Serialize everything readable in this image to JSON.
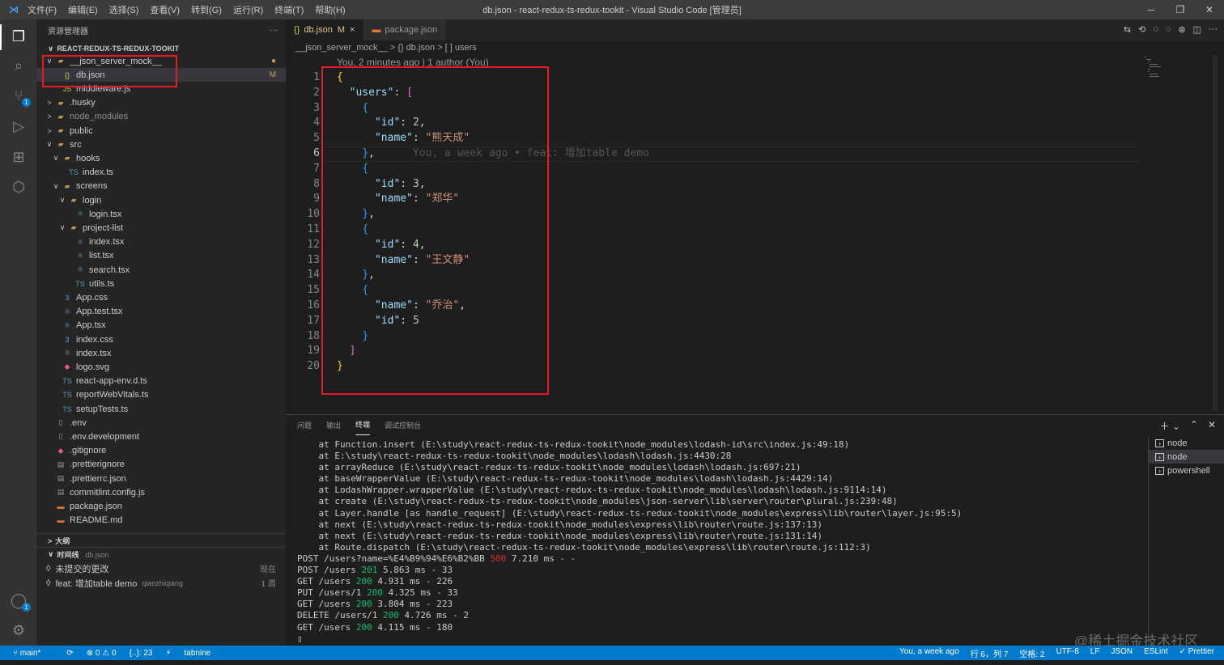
{
  "window": {
    "title": "db.json - react-redux-ts-redux-tookit - Visual Studio Code [管理员]",
    "menu": [
      "文件(F)",
      "编辑(E)",
      "选择(S)",
      "查看(V)",
      "转到(G)",
      "运行(R)",
      "终端(T)",
      "帮助(H)"
    ]
  },
  "activity": {
    "scm_badge": "1",
    "account_badge": "1"
  },
  "sidebar": {
    "header": "资源管理器",
    "more": "···",
    "project": "REACT-REDUX-TS-REDUX-TOOKIT",
    "tree": [
      {
        "label": "__json_server_mock__",
        "chev": "∨",
        "icon": "folder",
        "indent": 0,
        "status": "●"
      },
      {
        "label": "db.json",
        "chev": "",
        "icon": "{}",
        "indent": 1,
        "status": "M",
        "selected": true
      },
      {
        "label": "middleware.js",
        "chev": "",
        "icon": "JS",
        "indent": 1
      },
      {
        "label": ".husky",
        "chev": ">",
        "icon": "folder",
        "indent": 0
      },
      {
        "label": "node_modules",
        "chev": ">",
        "icon": "folder",
        "indent": 0,
        "dim": true
      },
      {
        "label": "public",
        "chev": ">",
        "icon": "folder",
        "indent": 0
      },
      {
        "label": "src",
        "chev": "∨",
        "icon": "folder",
        "indent": 0
      },
      {
        "label": "hooks",
        "chev": "∨",
        "icon": "folder",
        "indent": 1
      },
      {
        "label": "index.ts",
        "chev": "",
        "icon": "TS",
        "indent": 2
      },
      {
        "label": "screens",
        "chev": "∨",
        "icon": "folder",
        "indent": 1
      },
      {
        "label": "login",
        "chev": "∨",
        "icon": "folder",
        "indent": 2
      },
      {
        "label": "login.tsx",
        "chev": "",
        "icon": "⚛",
        "indent": 3
      },
      {
        "label": "project-list",
        "chev": "∨",
        "icon": "folder",
        "indent": 2
      },
      {
        "label": "index.tsx",
        "chev": "",
        "icon": "⚛",
        "indent": 3
      },
      {
        "label": "list.tsx",
        "chev": "",
        "icon": "⚛",
        "indent": 3
      },
      {
        "label": "search.tsx",
        "chev": "",
        "icon": "⚛",
        "indent": 3
      },
      {
        "label": "utils.ts",
        "chev": "",
        "icon": "TS",
        "indent": 3
      },
      {
        "label": "App.css",
        "chev": "",
        "icon": "3",
        "indent": 1
      },
      {
        "label": "App.test.tsx",
        "chev": "",
        "icon": "⚛",
        "indent": 1
      },
      {
        "label": "App.tsx",
        "chev": "",
        "icon": "⚛",
        "indent": 1
      },
      {
        "label": "index.css",
        "chev": "",
        "icon": "3",
        "indent": 1
      },
      {
        "label": "index.tsx",
        "chev": "",
        "icon": "⚛",
        "indent": 1
      },
      {
        "label": "logo.svg",
        "chev": "",
        "icon": "◆",
        "indent": 1
      },
      {
        "label": "react-app-env.d.ts",
        "chev": "",
        "icon": "TS",
        "indent": 1
      },
      {
        "label": "reportWebVitals.ts",
        "chev": "",
        "icon": "TS",
        "indent": 1
      },
      {
        "label": "setupTests.ts",
        "chev": "",
        "icon": "TS",
        "indent": 1
      },
      {
        "label": ".env",
        "chev": "",
        "icon": "▯",
        "indent": 0
      },
      {
        "label": ".env.development",
        "chev": "",
        "icon": "▯",
        "indent": 0
      },
      {
        "label": ".gitignore",
        "chev": "",
        "icon": "◆",
        "indent": 0
      },
      {
        "label": ".prettierignore",
        "chev": "",
        "icon": "▤",
        "indent": 0
      },
      {
        "label": ".prettierrc.json",
        "chev": "",
        "icon": "▤",
        "indent": 0
      },
      {
        "label": "commitlint.config.js",
        "chev": "",
        "icon": "▤",
        "indent": 0
      },
      {
        "label": "package.json",
        "chev": "",
        "icon": "▬",
        "indent": 0
      },
      {
        "label": "README.md",
        "chev": "",
        "icon": "▬",
        "indent": 0
      }
    ],
    "outline": "大纲",
    "timeline": {
      "title": "时间线",
      "file": "db.json",
      "items": [
        {
          "label": "未提交的更改",
          "author": "",
          "when": "现在"
        },
        {
          "label": "feat: 增加table demo",
          "author": "qiaozhiqiang",
          "when": "1 周"
        }
      ]
    }
  },
  "editor": {
    "tabs": [
      {
        "label": "db.json",
        "icon": "{}",
        "status": "M",
        "close": "×",
        "active": true
      },
      {
        "label": "package.json",
        "icon": "▬",
        "active": false
      }
    ],
    "breadcrumbs": "__json_server_mock__ > {} db.json > [ ] users",
    "codelens": "You, 2 minutes ago | 1 author (You)",
    "blame": "You, a week ago • feat: 增加table demo",
    "current_line": 6
  },
  "code_lines": [
    [
      [
        "b1",
        "{"
      ]
    ],
    [
      [
        "p",
        "  "
      ],
      [
        "k",
        "\"users\""
      ],
      [
        "p",
        ": "
      ],
      [
        "b2",
        "["
      ]
    ],
    [
      [
        "p",
        "    "
      ],
      [
        "b3",
        "{"
      ]
    ],
    [
      [
        "p",
        "      "
      ],
      [
        "k",
        "\"id\""
      ],
      [
        "p",
        ": "
      ],
      [
        "n",
        "2"
      ],
      [
        "p",
        ","
      ]
    ],
    [
      [
        "p",
        "      "
      ],
      [
        "k",
        "\"name\""
      ],
      [
        "p",
        ": "
      ],
      [
        "s",
        "\"熊天成\""
      ]
    ],
    [
      [
        "p",
        "    "
      ],
      [
        "b3",
        "}"
      ],
      [
        "p",
        ","
      ]
    ],
    [
      [
        "p",
        "    "
      ],
      [
        "b3",
        "{"
      ]
    ],
    [
      [
        "p",
        "      "
      ],
      [
        "k",
        "\"id\""
      ],
      [
        "p",
        ": "
      ],
      [
        "n",
        "3"
      ],
      [
        "p",
        ","
      ]
    ],
    [
      [
        "p",
        "      "
      ],
      [
        "k",
        "\"name\""
      ],
      [
        "p",
        ": "
      ],
      [
        "s",
        "\"郑华\""
      ]
    ],
    [
      [
        "p",
        "    "
      ],
      [
        "b3",
        "}"
      ],
      [
        "p",
        ","
      ]
    ],
    [
      [
        "p",
        "    "
      ],
      [
        "b3",
        "{"
      ]
    ],
    [
      [
        "p",
        "      "
      ],
      [
        "k",
        "\"id\""
      ],
      [
        "p",
        ": "
      ],
      [
        "n",
        "4"
      ],
      [
        "p",
        ","
      ]
    ],
    [
      [
        "p",
        "      "
      ],
      [
        "k",
        "\"name\""
      ],
      [
        "p",
        ": "
      ],
      [
        "s",
        "\"王文静\""
      ]
    ],
    [
      [
        "p",
        "    "
      ],
      [
        "b3",
        "}"
      ],
      [
        "p",
        ","
      ]
    ],
    [
      [
        "p",
        "    "
      ],
      [
        "b3",
        "{"
      ]
    ],
    [
      [
        "p",
        "      "
      ],
      [
        "k",
        "\"name\""
      ],
      [
        "p",
        ": "
      ],
      [
        "s",
        "\"乔治\""
      ],
      [
        "p",
        ","
      ]
    ],
    [
      [
        "p",
        "      "
      ],
      [
        "k",
        "\"id\""
      ],
      [
        "p",
        ": "
      ],
      [
        "n",
        "5"
      ]
    ],
    [
      [
        "p",
        "    "
      ],
      [
        "b3",
        "}"
      ]
    ],
    [
      [
        "p",
        "  "
      ],
      [
        "b2",
        "]"
      ]
    ],
    [
      [
        "b1",
        "}"
      ]
    ]
  ],
  "panel": {
    "tabs": [
      "问题",
      "输出",
      "终端",
      "调试控制台"
    ],
    "active_tab": "终端",
    "terminal_lines": [
      [
        [
          "",
          "    at Function.insert (E:\\study\\react-redux-ts-redux-tookit\\node_modules\\lodash-id\\src\\index.js:49:18)"
        ]
      ],
      [
        [
          "",
          "    at E:\\study\\react-redux-ts-redux-tookit\\node_modules\\lodash\\lodash.js:4430:28"
        ]
      ],
      [
        [
          "",
          "    at arrayReduce (E:\\study\\react-redux-ts-redux-tookit\\node_modules\\lodash\\lodash.js:697:21)"
        ]
      ],
      [
        [
          "",
          "    at baseWrapperValue (E:\\study\\react-redux-ts-redux-tookit\\node_modules\\lodash\\lodash.js:4429:14)"
        ]
      ],
      [
        [
          "",
          "    at LodashWrapper.wrapperValue (E:\\study\\react-redux-ts-redux-tookit\\node_modules\\lodash\\lodash.js:9114:14)"
        ]
      ],
      [
        [
          "",
          "    at create (E:\\study\\react-redux-ts-redux-tookit\\node_modules\\json-server\\lib\\server\\router\\plural.js:239:48)"
        ]
      ],
      [
        [
          "",
          "    at Layer.handle [as handle_request] (E:\\study\\react-redux-ts-redux-tookit\\node_modules\\express\\lib\\router\\layer.js:95:5)"
        ]
      ],
      [
        [
          "",
          "    at next (E:\\study\\react-redux-ts-redux-tookit\\node_modules\\express\\lib\\router\\route.js:137:13)"
        ]
      ],
      [
        [
          "",
          "    at next (E:\\study\\react-redux-ts-redux-tookit\\node_modules\\express\\lib\\router\\route.js:131:14)"
        ]
      ],
      [
        [
          "",
          "    at Route.dispatch (E:\\study\\react-redux-ts-redux-tookit\\node_modules\\express\\lib\\router\\route.js:112:3)"
        ]
      ],
      [
        [
          "",
          "POST /users?name=%E4%B9%94%E6%B2%BB "
        ],
        [
          "r",
          "500"
        ],
        [
          "",
          " 7.210 ms - -"
        ]
      ],
      [
        [
          "",
          "POST /users "
        ],
        [
          "g",
          "201"
        ],
        [
          "",
          " 5.863 ms - 33"
        ]
      ],
      [
        [
          "",
          "GET /users "
        ],
        [
          "g",
          "200"
        ],
        [
          "",
          " 4.931 ms - 226"
        ]
      ],
      [
        [
          "",
          "PUT /users/1 "
        ],
        [
          "g",
          "200"
        ],
        [
          "",
          " 4.325 ms - 33"
        ]
      ],
      [
        [
          "",
          "GET /users "
        ],
        [
          "g",
          "200"
        ],
        [
          "",
          " 3.804 ms - 223"
        ]
      ],
      [
        [
          "",
          "DELETE /users/1 "
        ],
        [
          "g",
          "200"
        ],
        [
          "",
          " 4.726 ms - 2"
        ]
      ],
      [
        [
          "",
          "GET /users "
        ],
        [
          "g",
          "200"
        ],
        [
          "",
          " 4.115 ms - 180"
        ]
      ],
      [
        [
          "",
          "▯"
        ]
      ]
    ],
    "terminals": [
      "node",
      "node",
      "powershell"
    ],
    "selected_terminal": 1
  },
  "watermark": "@稀土掘金技术社区",
  "statusbar": {
    "branch": "main*",
    "sync": "⟳",
    "problems": "⊗ 0 ⚠ 0",
    "braces": "{..}: 23",
    "flash": "⚡",
    "tabnine": "tabnine",
    "right": [
      "You, a week ago",
      "行 6，列 7",
      "空格: 2",
      "UTF-8",
      "LF",
      "JSON",
      "ESLint",
      "✓ Prettier"
    ]
  }
}
